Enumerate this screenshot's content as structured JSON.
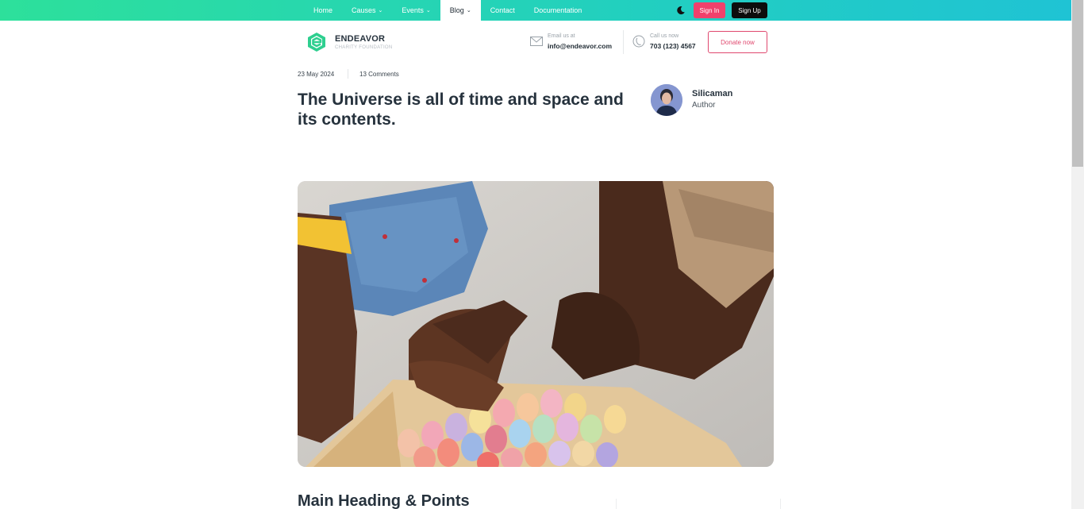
{
  "nav": {
    "items": [
      {
        "label": "Home",
        "has_dropdown": false,
        "active": false
      },
      {
        "label": "Causes",
        "has_dropdown": true,
        "active": false
      },
      {
        "label": "Events",
        "has_dropdown": true,
        "active": false
      },
      {
        "label": "Blog",
        "has_dropdown": true,
        "active": true
      },
      {
        "label": "Contact",
        "has_dropdown": false,
        "active": false
      },
      {
        "label": "Documentation",
        "has_dropdown": false,
        "active": false
      }
    ],
    "theme_toggle_icon": "moon-icon",
    "sign_in_label": "Sign In",
    "sign_up_label": "Sign Up"
  },
  "header": {
    "brand_name": "ENDEAVOR",
    "brand_tagline": "CHARITY FOUNDATION",
    "email_label": "Email us at",
    "email_value": "info@endeavor.com",
    "phone_label": "Call us now",
    "phone_value": "703 (123) 4567",
    "donate_label": "Donate now"
  },
  "post": {
    "date": "23 May 2024",
    "comments": "13 Comments",
    "title": "The Universe is all of time and space and its contents.",
    "author_name": "Silicaman",
    "author_role": "Author",
    "section_heading": "Main Heading & Points"
  },
  "colors": {
    "nav_gradient_start": "#2de09b",
    "nav_gradient_end": "#1fc3d4",
    "sign_in_bg": "#f0416c",
    "sign_up_bg": "#0d0d0d",
    "donate_accent": "#e0486e",
    "logo_green": "#2ecf8f"
  }
}
